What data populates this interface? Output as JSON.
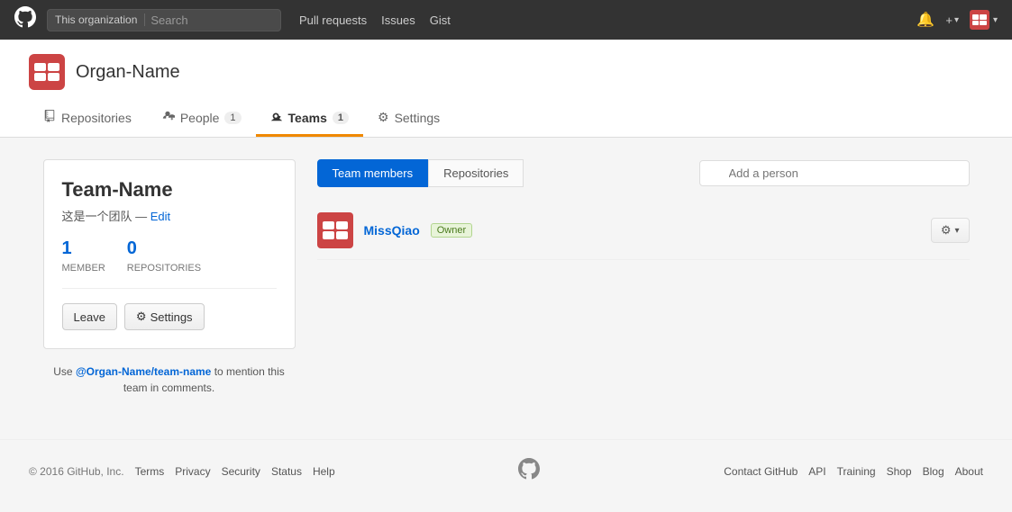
{
  "navbar": {
    "logo_label": "GitHub",
    "search_context": "This organization",
    "search_placeholder": "Search",
    "links": [
      "Pull requests",
      "Issues",
      "Gist"
    ],
    "notification_icon": "🔔",
    "plus_label": "+",
    "avatar_label": "User avatar"
  },
  "org": {
    "name": "Organ-Name",
    "tabs": [
      {
        "id": "repositories",
        "icon": "📁",
        "label": "Repositories",
        "count": null
      },
      {
        "id": "people",
        "icon": "👥",
        "label": "People",
        "count": "1"
      },
      {
        "id": "teams",
        "icon": "🏷",
        "label": "Teams",
        "count": "1",
        "active": true
      },
      {
        "id": "settings",
        "icon": "⚙",
        "label": "Settings",
        "count": null
      }
    ]
  },
  "sidebar": {
    "team_name": "Team-Name",
    "team_desc": "这是一个团队",
    "team_desc_separator": "—",
    "edit_label": "Edit",
    "member_count": "1",
    "member_label": "MEMBER",
    "repo_count": "0",
    "repo_label": "REPOSITORIES",
    "leave_label": "Leave",
    "settings_label": "Settings",
    "mention_prefix": "Use",
    "mention_link": "@Organ-Name/team-name",
    "mention_suffix": "to mention this team in comments."
  },
  "team_main": {
    "tabs": [
      {
        "id": "members",
        "label": "Team members",
        "active": true
      },
      {
        "id": "repositories",
        "label": "Repositories",
        "active": false
      }
    ],
    "add_person_placeholder": "Add a person",
    "members": [
      {
        "username": "MissQiao",
        "role": "Owner",
        "avatar_alt": "MissQiao avatar"
      }
    ]
  },
  "footer": {
    "copyright": "© 2016 GitHub, Inc.",
    "links_left": [
      "Terms",
      "Privacy",
      "Security",
      "Status",
      "Help"
    ],
    "links_right": [
      "Contact GitHub",
      "API",
      "Training",
      "Shop",
      "Blog",
      "About"
    ]
  }
}
